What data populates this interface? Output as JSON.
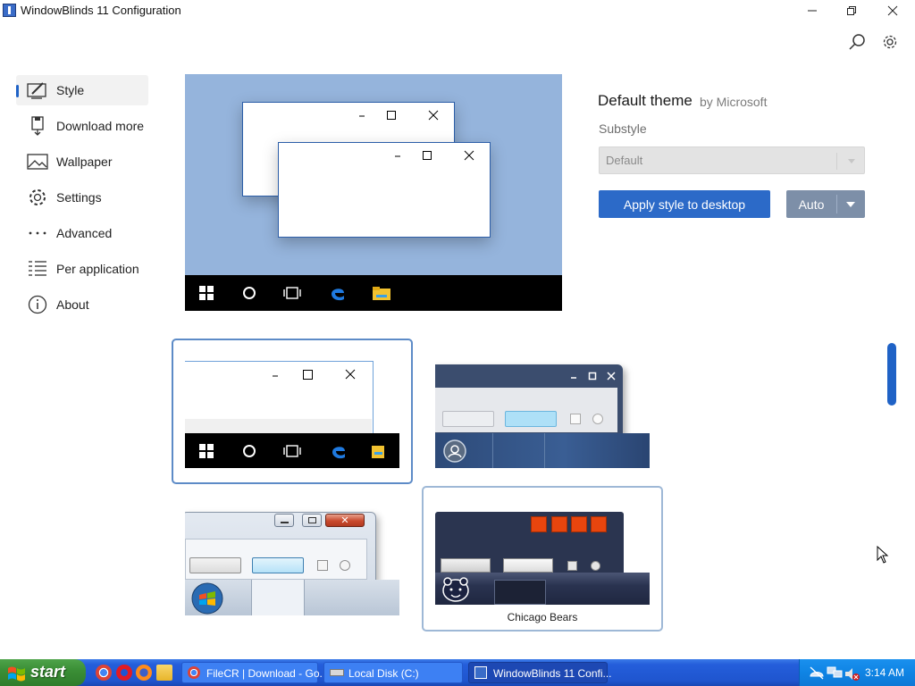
{
  "window": {
    "title": "WindowBlinds 11 Configuration"
  },
  "sidebar": {
    "items": [
      {
        "label": "Style",
        "icon": "style-brush-icon",
        "active": true
      },
      {
        "label": "Download more",
        "icon": "download-icon",
        "active": false
      },
      {
        "label": "Wallpaper",
        "icon": "wallpaper-icon",
        "active": false
      },
      {
        "label": "Settings",
        "icon": "gear-icon",
        "active": false
      },
      {
        "label": "Advanced",
        "icon": "ellipsis-icon",
        "active": false
      },
      {
        "label": "Per application",
        "icon": "list-icon",
        "active": false
      },
      {
        "label": "About",
        "icon": "info-icon",
        "active": false
      }
    ]
  },
  "theme": {
    "name": "Default theme",
    "by": "by Microsoft",
    "substyle_label": "Substyle",
    "substyle_value": "Default",
    "apply_label": "Apply style to desktop",
    "auto_label": "Auto"
  },
  "thumbnails": {
    "caption": "Chicago Bears"
  },
  "taskbar": {
    "start_label": "start",
    "tasks": [
      {
        "label": "FileCR | Download - Go...",
        "active": false
      },
      {
        "label": "Local Disk (C:)",
        "active": false
      },
      {
        "label": "WindowBlinds 11 Confi...",
        "active": true
      }
    ],
    "clock": "3:14 AM"
  },
  "colors": {
    "accent": "#2c6ac8",
    "preview_bg": "#95b4dc",
    "xp_taskbar": "#245edb",
    "xp_start": "#3b8f36"
  }
}
